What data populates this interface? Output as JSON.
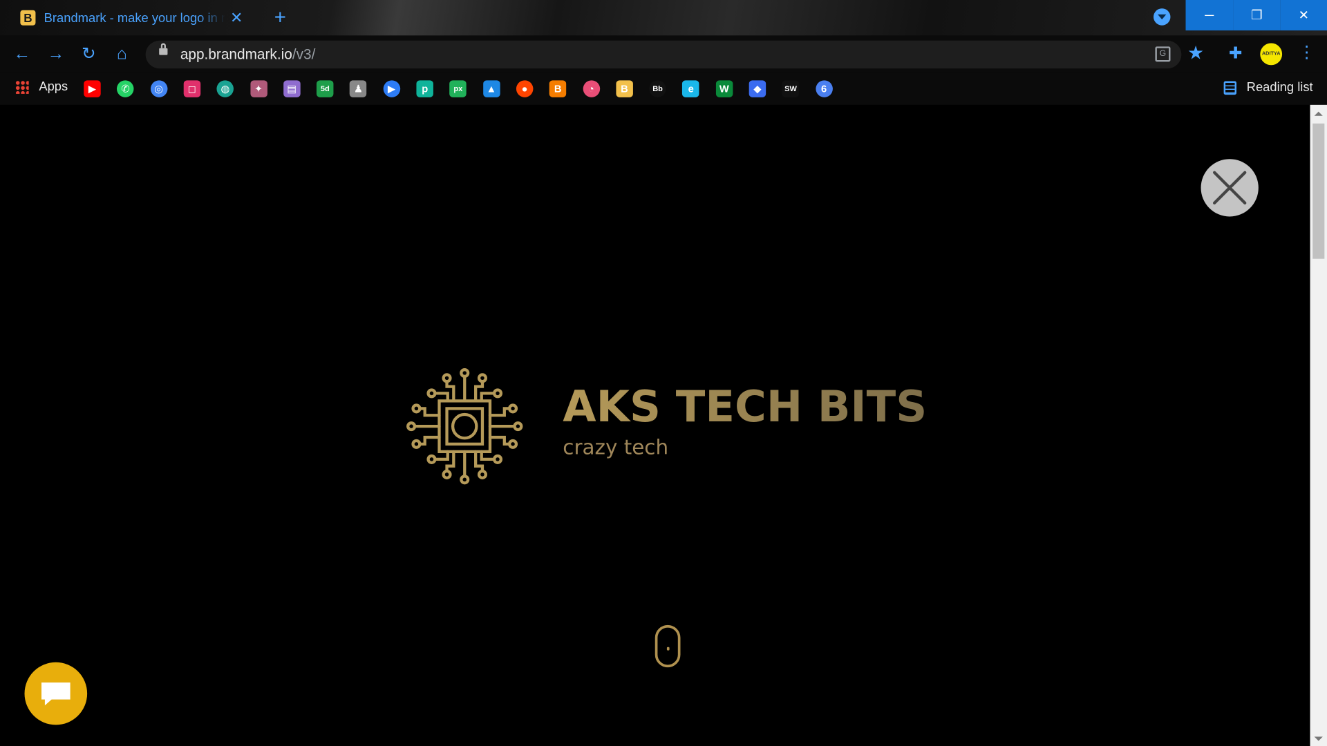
{
  "browser": {
    "tab": {
      "favicon_letter": "B",
      "title": "Brandmark - make your logo in minutes"
    },
    "address": {
      "host": "app.brandmark.io",
      "path": "/v3/"
    },
    "profile_badge": "ADITYA",
    "bookmarks_bar": {
      "apps_label": "Apps",
      "items": [
        {
          "name": "youtube",
          "color": "#ff0000",
          "glyph": "▶"
        },
        {
          "name": "whatsapp",
          "color": "#25d366",
          "glyph": "✆"
        },
        {
          "name": "podcasts",
          "color": "#4285f4",
          "glyph": "◎"
        },
        {
          "name": "instagram",
          "color": "#e1306c",
          "glyph": "◻"
        },
        {
          "name": "site-teal",
          "color": "#1aa393",
          "glyph": "◍"
        },
        {
          "name": "avatar-art",
          "color": "#b05a7a",
          "glyph": "✦"
        },
        {
          "name": "rainbow-app",
          "color": "#8f6ccf",
          "glyph": "▤"
        },
        {
          "name": "5d",
          "color": "#1e9e4a",
          "glyph": "5d"
        },
        {
          "name": "joystick",
          "color": "#888888",
          "glyph": "♟"
        },
        {
          "name": "play-circle",
          "color": "#2d7cf6",
          "glyph": "▶"
        },
        {
          "name": "picsart",
          "color": "#0fb39a",
          "glyph": "p"
        },
        {
          "name": "px",
          "color": "#21b15a",
          "glyph": "px"
        },
        {
          "name": "flask",
          "color": "#1e88e5",
          "glyph": "▲"
        },
        {
          "name": "reddit",
          "color": "#ff4500",
          "glyph": "●"
        },
        {
          "name": "blogger",
          "color": "#f57d00",
          "glyph": "B"
        },
        {
          "name": "swirl",
          "color": "#e94e77",
          "glyph": "◔"
        },
        {
          "name": "brandmark",
          "color": "#f2c04b",
          "glyph": "B"
        },
        {
          "name": "bb",
          "color": "#111111",
          "glyph": "Bb"
        },
        {
          "name": "edge",
          "color": "#1ab7ea",
          "glyph": "e"
        },
        {
          "name": "w",
          "color": "#0a8a3a",
          "glyph": "W"
        },
        {
          "name": "flag-app",
          "color": "#3b6cf0",
          "glyph": "◆"
        },
        {
          "name": "sw",
          "color": "#111111",
          "glyph": "SW"
        },
        {
          "name": "circle-app",
          "color": "#4a7ff0",
          "glyph": "6"
        }
      ]
    },
    "reading_list_label": "Reading list",
    "window_controls": [
      "minimize",
      "restore",
      "close"
    ]
  },
  "page": {
    "logo": {
      "brand_name": "AKS TECH BITS",
      "tagline": "crazy tech",
      "icon": "circuit-chip-icon",
      "gold": "#b59a59"
    },
    "close_button_color": "#c4c4c4",
    "chat_button_color": "#e8ae0c",
    "background": "#000000"
  }
}
